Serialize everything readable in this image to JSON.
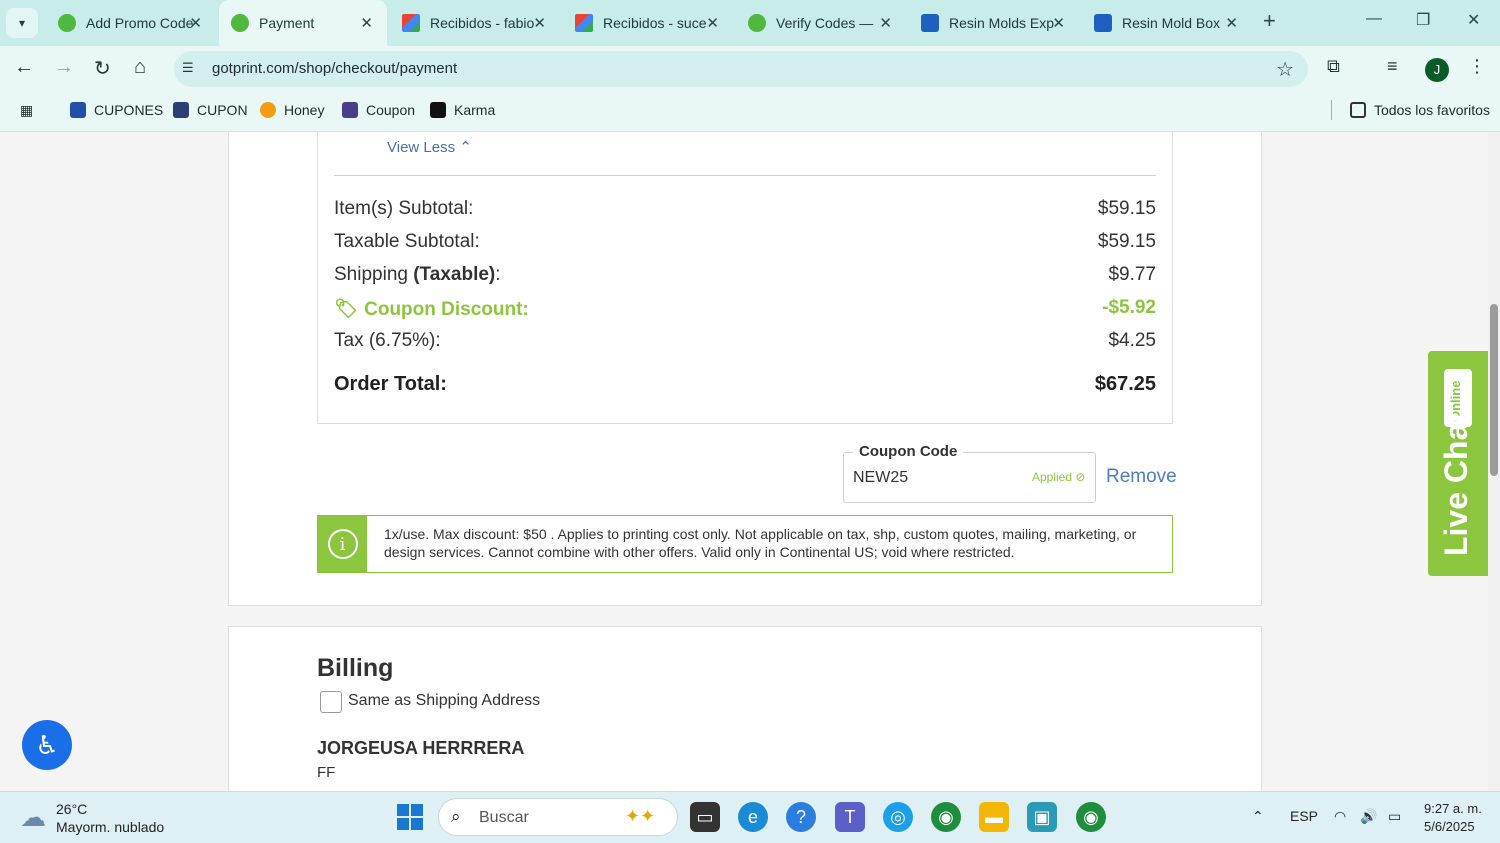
{
  "browser": {
    "tabs": [
      {
        "title": "Add Promo Code",
        "icon": "gotprint-green-icon",
        "active": false
      },
      {
        "title": "Payment",
        "icon": "gotprint-green-icon",
        "active": true
      },
      {
        "title": "Recibidos - fabio",
        "icon": "gmail-icon",
        "active": false
      },
      {
        "title": "Recibidos - suce",
        "icon": "gmail-icon",
        "active": false
      },
      {
        "title": "Verify Codes —",
        "icon": "gotprint-green-icon",
        "active": false
      },
      {
        "title": "Resin Molds Exp",
        "icon": "cube-icon",
        "active": false
      },
      {
        "title": "Resin Mold Box",
        "icon": "cube-icon",
        "active": false
      }
    ],
    "url": "gotprint.com/shop/checkout/payment",
    "bookmarks": [
      "CUPONES",
      "CUPON",
      "Honey",
      "Coupon",
      "Karma"
    ],
    "all_bookmarks": "Todos los favoritos",
    "profile_initial": "J"
  },
  "summary": {
    "view_less": "View Less",
    "rows": [
      {
        "label": "Item(s) Subtotal:",
        "value": "$59.15"
      },
      {
        "label": "Taxable Subtotal:",
        "value": "$59.15"
      },
      {
        "label": "Shipping ",
        "label_bold": "(Taxable)",
        "label_suffix": ":",
        "value": "$9.77"
      },
      {
        "label": "Coupon Discount:",
        "value": "-$5.92"
      },
      {
        "label": "Tax (6.75%):",
        "value": "$4.25"
      }
    ],
    "total_label": "Order Total:",
    "total_value": "$67.25"
  },
  "coupon": {
    "legend": "Coupon Code",
    "value": "NEW25",
    "status": "Applied",
    "remove_label": "Remove"
  },
  "notice": {
    "text": "1x/use. Max discount: $50 . Applies to printing cost only. Not applicable on tax, shp, custom quotes, mailing, marketing, or design services. Cannot combine with other offers. Valid only in Continental US; void where restricted."
  },
  "billing": {
    "title": "Billing",
    "same_as_shipping": "Same as Shipping Address",
    "name": "JORGEUSA HERRRERA",
    "line1": "FF"
  },
  "widgets": {
    "live_chat": "Live Chat",
    "online": "Online"
  },
  "taskbar": {
    "temperature": "26°C",
    "weather": "Mayorm. nublado",
    "search_placeholder": "Buscar",
    "language": "ESP",
    "time": "9:27 a. m.",
    "date": "5/6/2025"
  },
  "colors": {
    "accent_green": "#8cc63f",
    "link_blue": "#4b7fbf",
    "tabstrip": "#c8ecea"
  }
}
